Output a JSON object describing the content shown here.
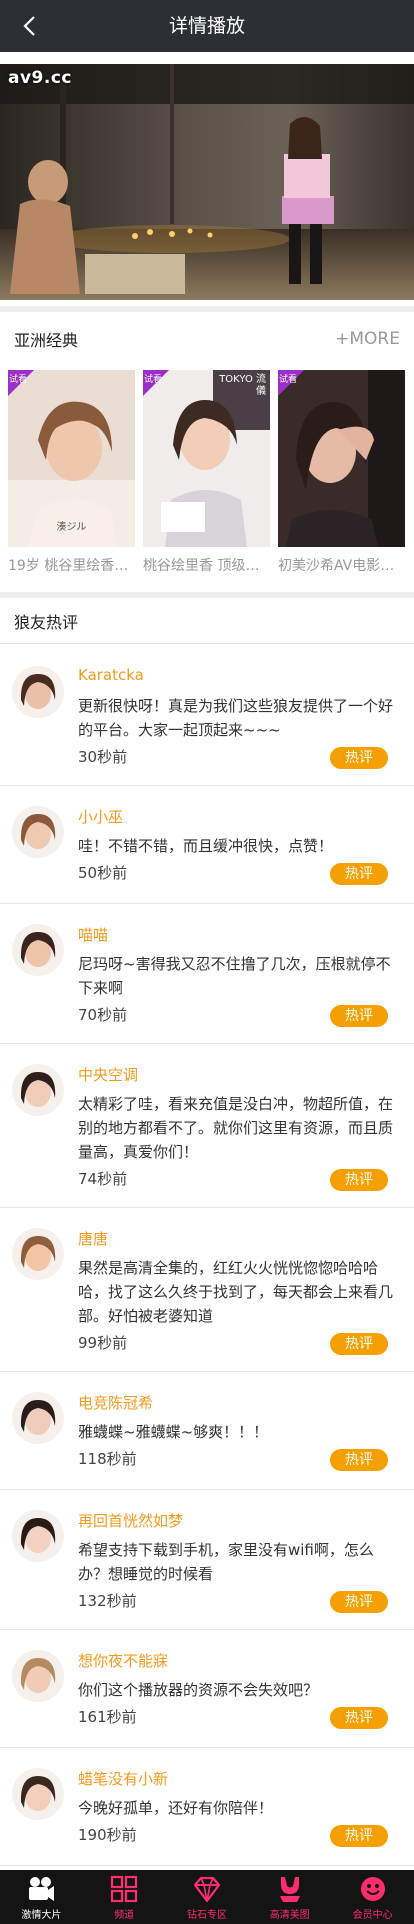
{
  "header": {
    "title": "详情播放"
  },
  "player": {
    "watermark": "av9.cc"
  },
  "section_classic": {
    "title": "亚洲经典",
    "more_label": "+MORE",
    "items": [
      {
        "caption": "19岁 桃谷里绘香…",
        "badge": "试看",
        "cover_text": "湊ジル"
      },
      {
        "caption": "桃谷绘里香 顶级…",
        "badge": "试看",
        "cover_text": "TOKYO 流儀"
      },
      {
        "caption": "初美沙希AV电影…",
        "badge": "试看",
        "cover_text": ""
      }
    ]
  },
  "comments": {
    "title": "狼友热评",
    "hot_label": "热评",
    "items": [
      {
        "author": "Karatcka",
        "text": "更新很快呀！真是为我们这些狼友提供了一个好的平台。大家一起顶起来~~~",
        "time": "30秒前"
      },
      {
        "author": "小小巫",
        "text": "哇！不错不错，而且缓冲很快，点赞！",
        "time": "50秒前"
      },
      {
        "author": "喵喵",
        "text": "尼玛呀~害得我又忍不住撸了几次，压根就停不下来啊",
        "time": "70秒前"
      },
      {
        "author": "中央空调",
        "text": "太精彩了哇，看来充值是没白冲，物超所值，在别的地方都看不了。就你们这里有资源，而且质量高，真爱你们！",
        "time": "74秒前"
      },
      {
        "author": "唐唐",
        "text": "果然是高清全集的，红红火火恍恍惚惚哈哈哈哈，找了这么久终于找到了，每天都会上来看几部。好怕被老婆知道",
        "time": "99秒前"
      },
      {
        "author": "电竞陈冠希",
        "text": "雅蠛蝶~雅蠛蝶~够爽！！！",
        "time": "118秒前"
      },
      {
        "author": "再回首恍然如梦",
        "text": "希望支持下载到手机，家里没有wifi啊，怎么办？想睡觉的时候看",
        "time": "132秒前"
      },
      {
        "author": "想你夜不能寐",
        "text": "你们这个播放器的资源不会失效吧？",
        "time": "161秒前"
      },
      {
        "author": "蜡笔没有小新",
        "text": "今晚好孤单，还好有你陪伴！",
        "time": "190秒前"
      }
    ]
  },
  "tabbar": {
    "items": [
      {
        "label": "激情大片",
        "icon": "film-camera-icon"
      },
      {
        "label": "频道",
        "icon": "grid-icon"
      },
      {
        "label": "钻石专区",
        "icon": "diamond-icon"
      },
      {
        "label": "高清美图",
        "icon": "lingerie-icon"
      },
      {
        "label": "会员中心",
        "icon": "smile-face-icon"
      }
    ]
  },
  "colors": {
    "header_bg": "#2e2f34",
    "accent_orange": "#f39a1c",
    "hot_badge": "#f5a000",
    "tab_pink": "#ff2d6e",
    "trial_badge": "#9b2fc9"
  }
}
